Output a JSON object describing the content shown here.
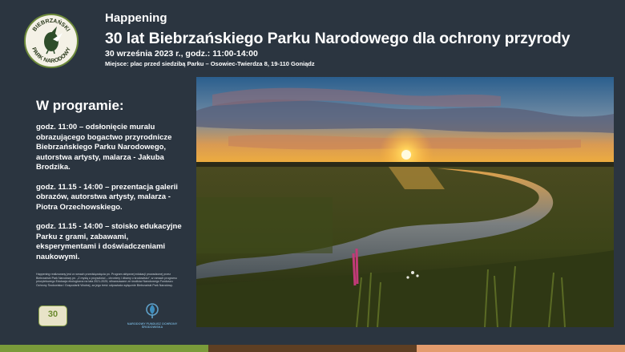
{
  "header": {
    "logo_text_top": "BIEBRZAŃSKI",
    "logo_text_bottom": "PARK NARODOWY",
    "event_type": "Happening",
    "title": "30 lat Biebrzańskiego Parku Narodowego dla ochrony przyrody",
    "date": "30 września 2023 r., godz.: 11:00-14:00",
    "place": "Miejsce: plac przed siedzibą Parku – Osowiec-Twierdza 8, 19-110 Goniądz"
  },
  "program": {
    "heading": "W programie:",
    "items": [
      "godz. 11:00 – odsłonięcie muralu obrazującego bogactwo przyrodnicze Biebrzańskiego Parku Narodowego, autorstwa artysty, malarza - Jakuba Brodzika.",
      "godz. 11.15 - 14:00 – prezentacja galerii obrazów, autorstwa artysty, malarza - Piotra Orzechowskiego.",
      "godz. 11.15 - 14:00 – stoisko edukacyjne Parku z grami, zabawami, eksperymentami i doświadczeniami naukowymi."
    ]
  },
  "footer": {
    "footnote": "Happening realizowany jest w ramach przedsięwzięcia pn. Program aktywnej edukacji prowadzonej przez Biebrzański Park Narodowy pn. „Z myślą o przyszłości – chronimy i dbamy o środowisko”, w ramach programu priorytetowego Edukacja ekologiczna na lata 2021-2025, sfinansowane ze środków Narodowego Funduszu Ochrony Środowiska i Gospodarki Wodnej, za jego treść odpowiada wyłącznie Biebrzański Park Narodowy.",
    "badge_text": "30",
    "nfos_text": "NARODOWY FUNDUSZ OCHRONY ŚRODOWISKA"
  },
  "colors": {
    "background": "#2b3540",
    "bar_green": "#7a9b3a",
    "bar_brown": "#5e3f23",
    "bar_peach": "#e39c6d"
  }
}
